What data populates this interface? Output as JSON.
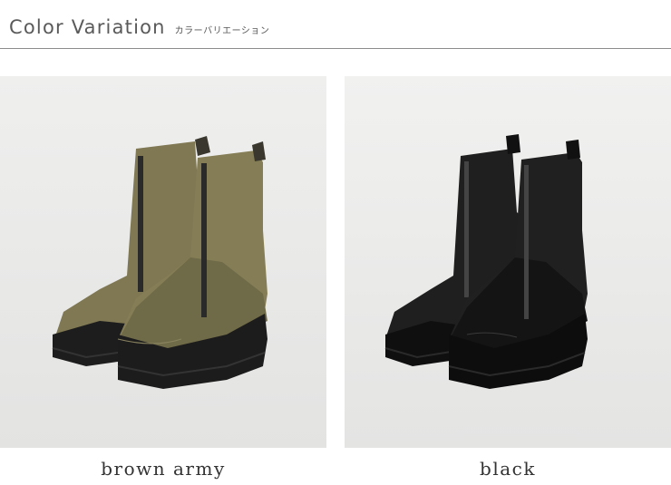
{
  "header": {
    "title": "Color Variation",
    "subtitle": "カラーバリエーション"
  },
  "variations": [
    {
      "label": "brown army",
      "color": "#7d7650"
    },
    {
      "label": "black",
      "color": "#1c1c1c"
    }
  ]
}
